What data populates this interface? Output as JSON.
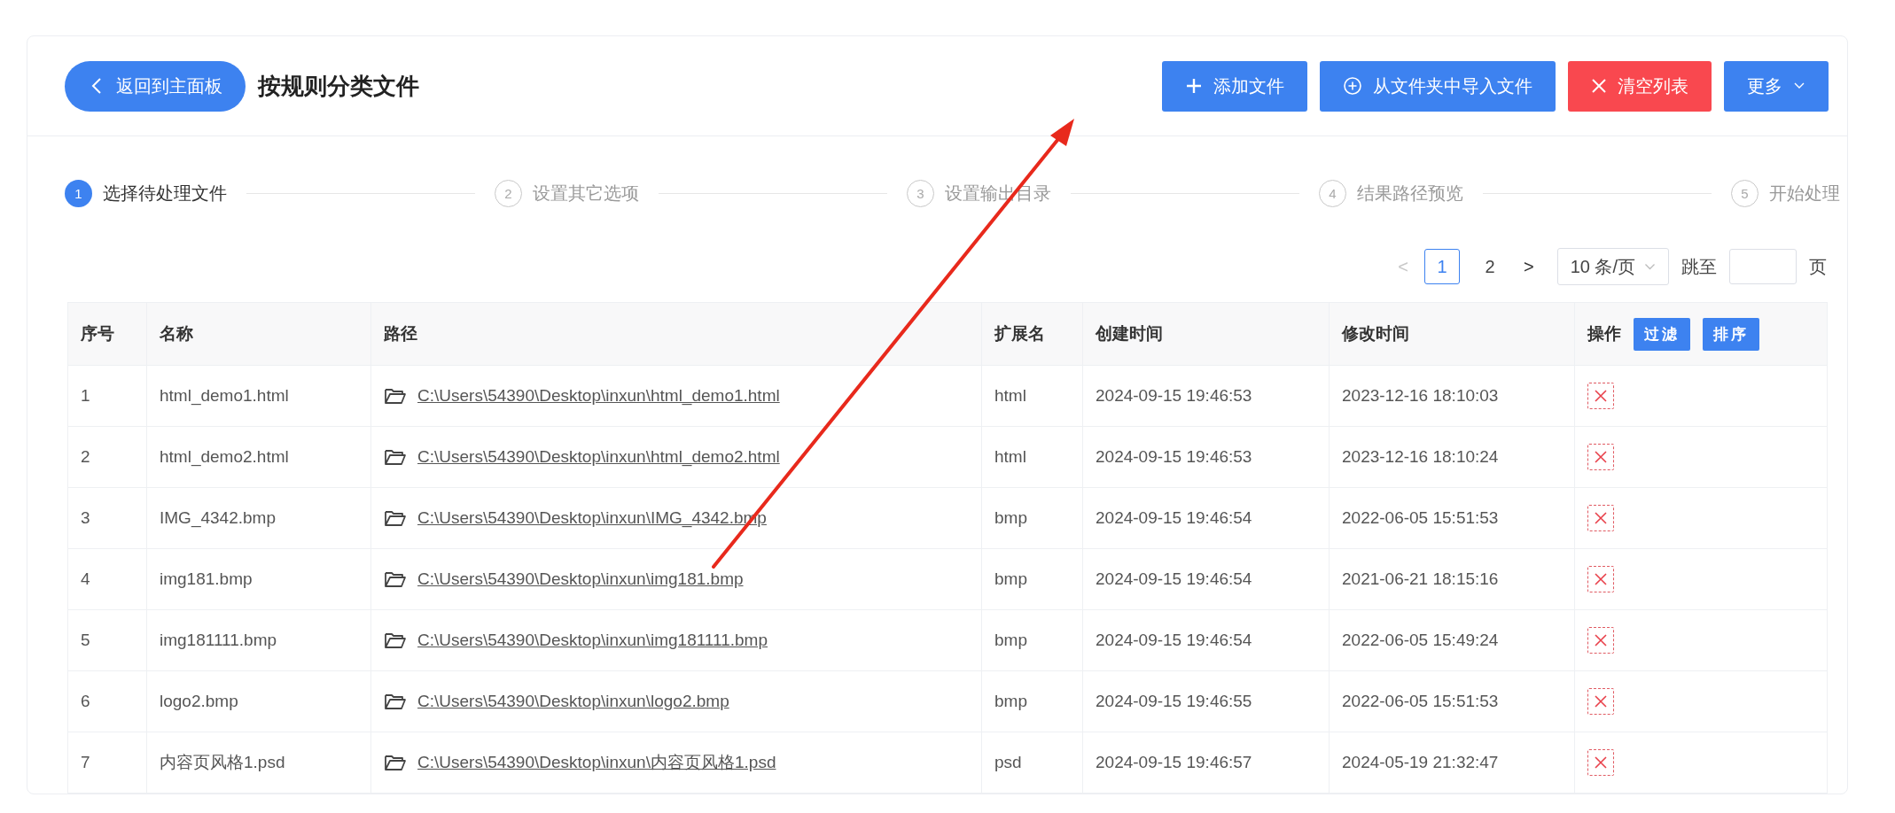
{
  "header": {
    "back_button": "返回到主面板",
    "title": "按规则分类文件",
    "actions": [
      {
        "kind": "add",
        "label": "添加文件"
      },
      {
        "kind": "import",
        "label": "从文件夹中导入文件"
      },
      {
        "kind": "clear",
        "label": "清空列表"
      },
      {
        "kind": "more",
        "label": "更多"
      }
    ]
  },
  "steps": [
    {
      "number": "1",
      "label": "选择待处理文件",
      "selected": true
    },
    {
      "number": "2",
      "label": "设置其它选项",
      "selected": false
    },
    {
      "number": "3",
      "label": "设置输出目录",
      "selected": false
    },
    {
      "number": "4",
      "label": "结果路径预览",
      "selected": false
    },
    {
      "number": "5",
      "label": "开始处理",
      "selected": false
    }
  ],
  "pagination": {
    "prev": {
      "label": "<",
      "disabled": true
    },
    "pages": [
      {
        "label": "1",
        "selected": true
      },
      {
        "label": "2",
        "selected": false
      }
    ],
    "next": {
      "label": ">",
      "disabled": false
    },
    "page_size": "10 条/页",
    "jump_label": "跳至",
    "jump_suffix": "页"
  },
  "table": {
    "columns": [
      "序号",
      "名称",
      "路径",
      "扩展名",
      "创建时间",
      "修改时间",
      "操作"
    ],
    "header_buttons": [
      "过滤",
      "排序"
    ],
    "rows": [
      {
        "index": "1",
        "name": "html_demo1.html",
        "path": "C:\\Users\\54390\\Desktop\\inxun\\html_demo1.html",
        "extension": "html",
        "created": "2024-09-15 19:46:53",
        "modified": "2023-12-16 18:10:03"
      },
      {
        "index": "2",
        "name": "html_demo2.html",
        "path": "C:\\Users\\54390\\Desktop\\inxun\\html_demo2.html",
        "extension": "html",
        "created": "2024-09-15 19:46:53",
        "modified": "2023-12-16 18:10:24"
      },
      {
        "index": "3",
        "name": "IMG_4342.bmp",
        "path": "C:\\Users\\54390\\Desktop\\inxun\\IMG_4342.bmp",
        "extension": "bmp",
        "created": "2024-09-15 19:46:54",
        "modified": "2022-06-05 15:51:53"
      },
      {
        "index": "4",
        "name": "img181.bmp",
        "path": "C:\\Users\\54390\\Desktop\\inxun\\img181.bmp",
        "extension": "bmp",
        "created": "2024-09-15 19:46:54",
        "modified": "2021-06-21 18:15:16"
      },
      {
        "index": "5",
        "name": "img181111.bmp",
        "path": "C:\\Users\\54390\\Desktop\\inxun\\img181111.bmp",
        "extension": "bmp",
        "created": "2024-09-15 19:46:54",
        "modified": "2022-06-05 15:49:24"
      },
      {
        "index": "6",
        "name": "logo2.bmp",
        "path": "C:\\Users\\54390\\Desktop\\inxun\\logo2.bmp",
        "extension": "bmp",
        "created": "2024-09-15 19:46:55",
        "modified": "2022-06-05 15:51:53"
      },
      {
        "index": "7",
        "name": "内容页风格1.psd",
        "path": "C:\\Users\\54390\\Desktop\\inxun\\内容页风格1.psd",
        "extension": "psd",
        "created": "2024-09-15 19:46:57",
        "modified": "2024-05-19 21:32:47"
      }
    ]
  }
}
